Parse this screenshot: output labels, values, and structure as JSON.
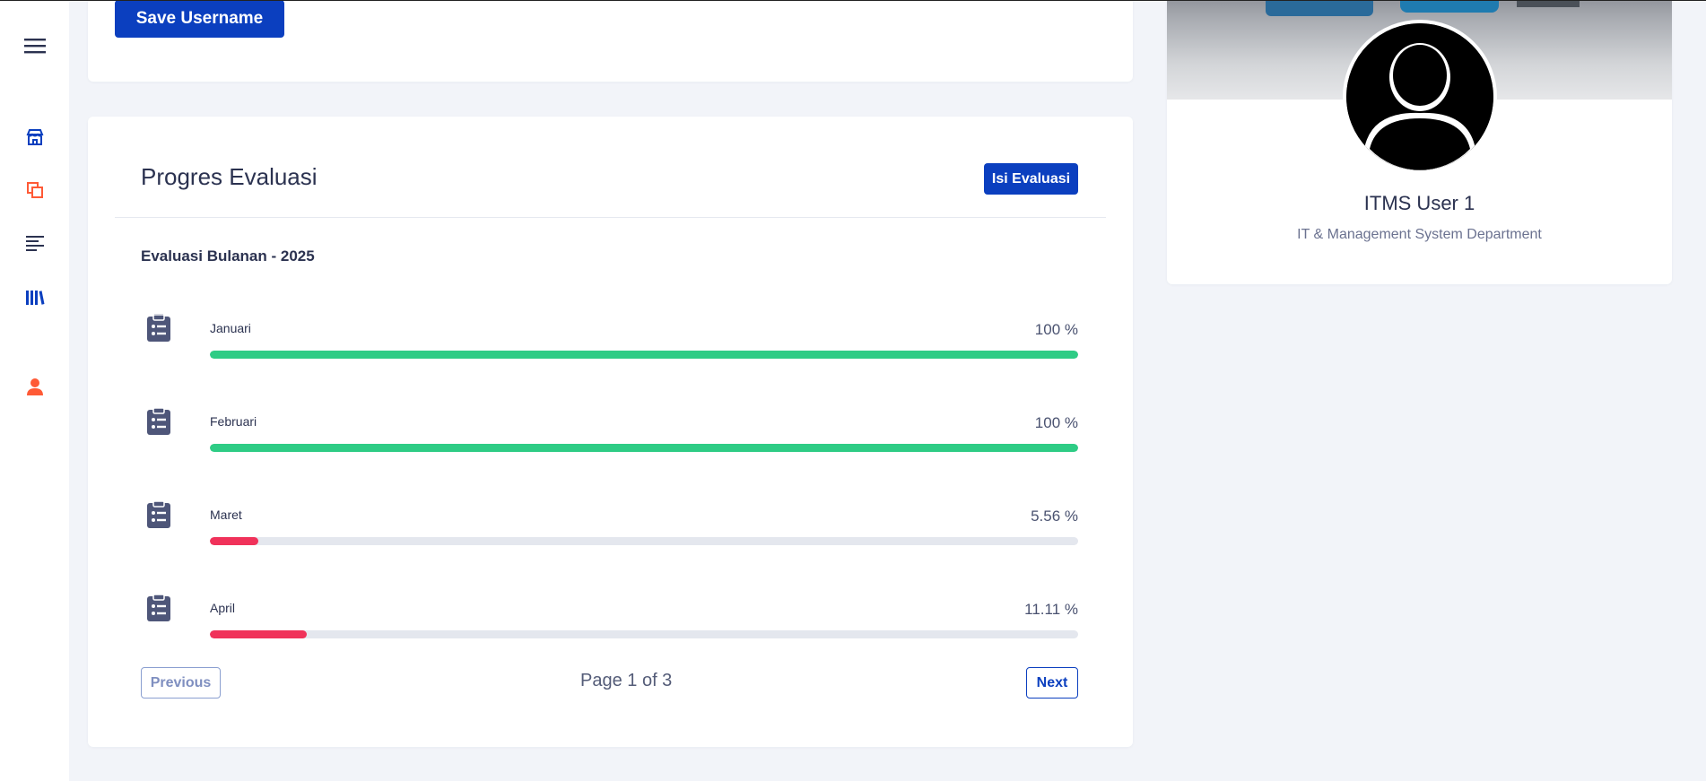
{
  "sidebar": {
    "items": [
      {
        "icon": "hamburger-menu-icon",
        "color": "#2b3250"
      },
      {
        "icon": "store-icon",
        "color": "#0b3fbf"
      },
      {
        "icon": "copy-squares-icon",
        "color": "#ff5a36"
      },
      {
        "icon": "align-left-icon",
        "color": "#2b3250"
      },
      {
        "icon": "library-books-icon",
        "color": "#0b3fbf"
      },
      {
        "icon": "user-icon",
        "color": "#ff5a36"
      }
    ]
  },
  "account": {
    "save_label": "Save Username"
  },
  "evaluation": {
    "title": "Progres Evaluasi",
    "fill_button": "Isi Evaluasi",
    "section_title": "Evaluasi Bulanan - 2025",
    "rows": [
      {
        "month": "Januari",
        "percent_label": "100 %",
        "percent": 100,
        "color": "#2ecc85"
      },
      {
        "month": "Februari",
        "percent_label": "100 %",
        "percent": 100,
        "color": "#2ecc85"
      },
      {
        "month": "Maret",
        "percent_label": "5.56 %",
        "percent": 5.56,
        "color": "#f0325a"
      },
      {
        "month": "April",
        "percent_label": "11.11 %",
        "percent": 11.11,
        "color": "#f0325a"
      }
    ],
    "pagination": {
      "previous_label": "Previous",
      "page_info": "Page 1 of 3",
      "next_label": "Next"
    }
  },
  "profile": {
    "name": "ITMS User 1",
    "department": "IT & Management System Department"
  },
  "colors": {
    "primary": "#0b3fbf",
    "success": "#2ecc85",
    "danger": "#f0325a",
    "accent_orange": "#ff5a36"
  }
}
